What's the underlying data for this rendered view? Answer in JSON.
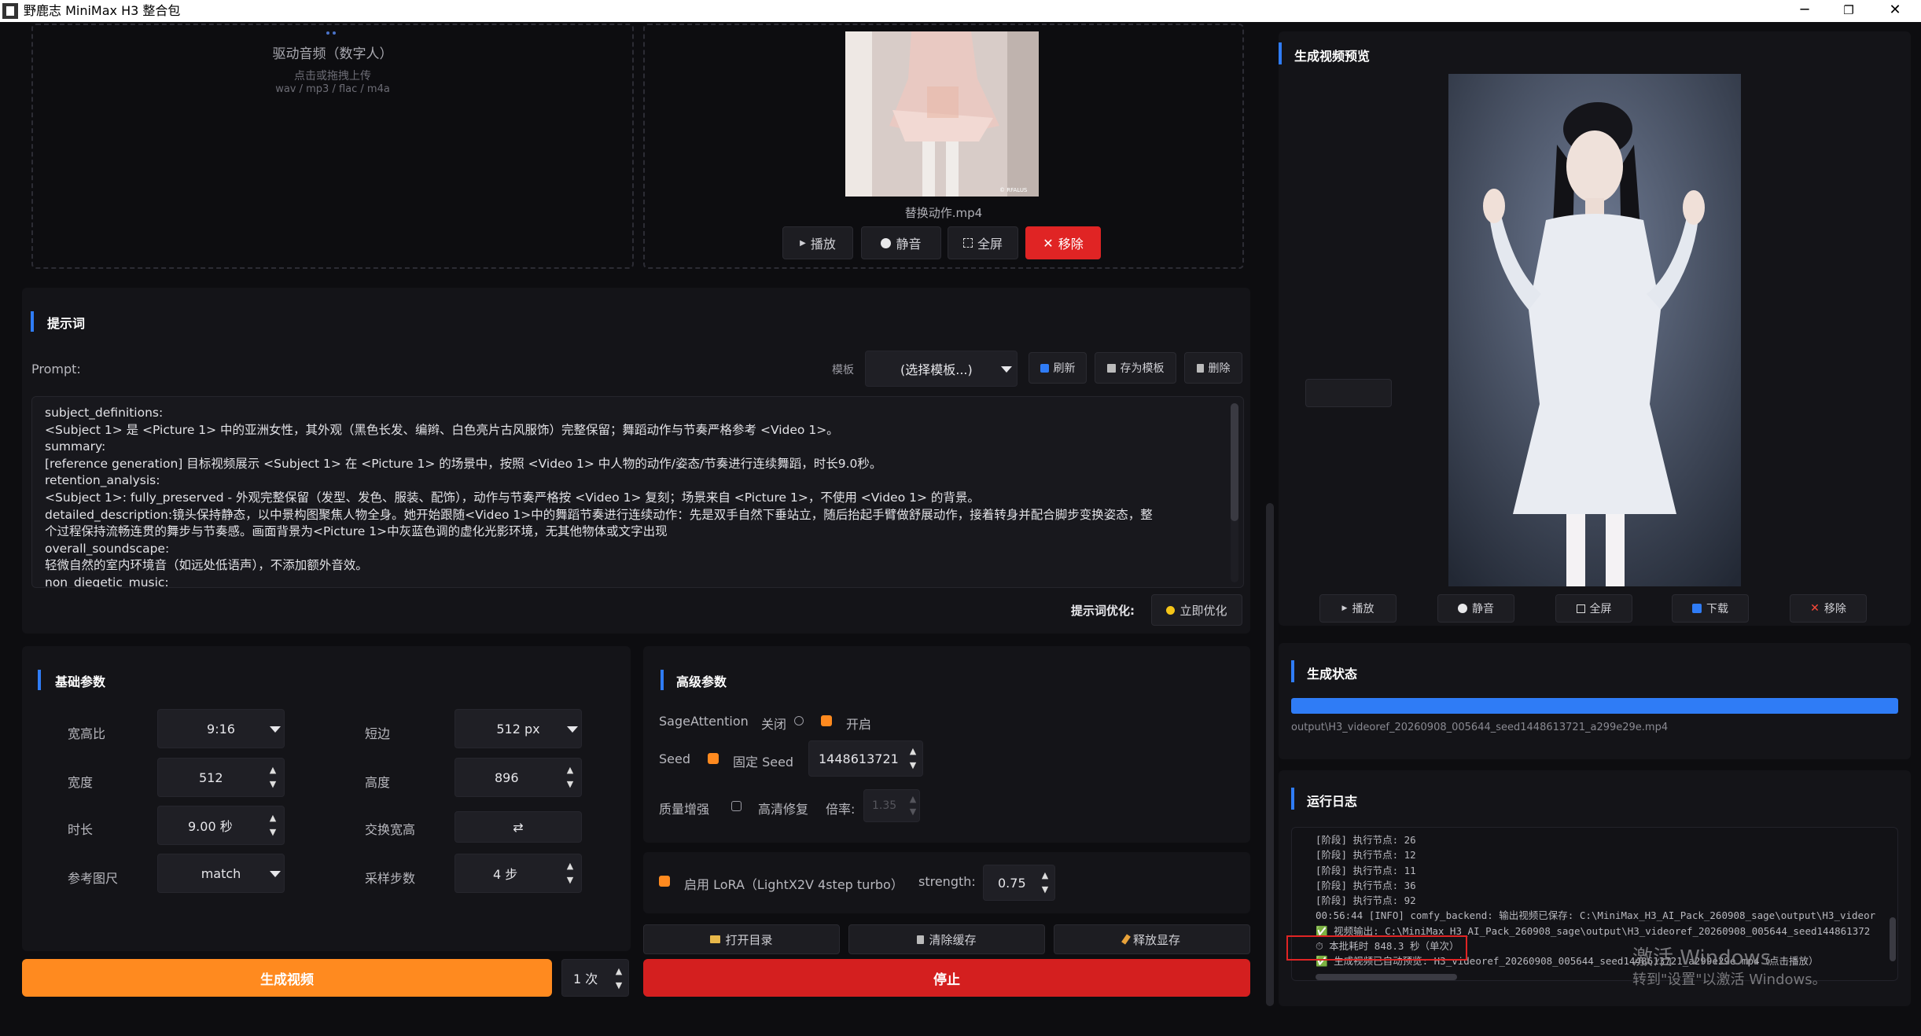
{
  "window": {
    "title": "野鹿志 MiniMax H3 整合包",
    "minimize": "─",
    "restore": "❐",
    "close": "✕"
  },
  "upload_audio": {
    "title": "驱动音频（数字人）",
    "hint": "点击或拖拽上传",
    "formats": "wav / mp3 / flac / m4a"
  },
  "video_ref": {
    "filename": "替换动作.mp4",
    "watermark": "© RFALUS",
    "buttons": {
      "play": "播放",
      "mute": "静音",
      "fullscreen": "全屏",
      "remove": "移除"
    }
  },
  "prompt_section": {
    "title": "提示词",
    "prompt_label": "Prompt:",
    "template_label": "模板",
    "template_select": "(选择模板...)",
    "refresh": "刷新",
    "save_template": "存为模板",
    "delete": "删除",
    "lines": [
      "subject_definitions:",
      "<Subject 1> 是 <Picture 1> 中的亚洲女性，其外观（黑色长发、编辫、白色亮片古风服饰）完整保留；舞蹈动作与节奏严格参考 <Video 1>。",
      "summary:",
      "[reference generation] 目标视频展示 <Subject 1> 在 <Picture 1> 的场景中，按照 <Video 1> 中人物的动作/姿态/节奏进行连续舞蹈，时长9.0秒。",
      "retention_analysis:",
      "<Subject 1>: fully_preserved - 外观完整保留（发型、发色、服装、配饰），动作与节奏严格按 <Video 1> 复刻；场景来自 <Picture 1>，不使用 <Video 1> 的背景。",
      "detailed_description:镜头保持静态，以中景构图聚焦人物全身。她开始跟随<Video 1>中的舞蹈节奏进行连续动作：先是双手自然下垂站立，随后抬起手臂做舒展动作，接着转身并配合脚步变换姿态，整",
      "个过程保持流畅连贯的舞步与节奏感。画面背景为<Picture 1>中灰蓝色调的虚化光影环境，无其他物体或文字出现",
      "overall_soundscape:",
      "轻微自然的室内环境音（如远处低语声），不添加额外音效。",
      "non_diegetic_music:"
    ],
    "optimize_label": "提示词优化:",
    "optimize_button": "立即优化"
  },
  "basic_params": {
    "title": "基础参数",
    "aspect_label": "宽高比",
    "aspect_value": "9:16",
    "short_edge_label": "短边",
    "short_edge_value": "512 px",
    "width_label": "宽度",
    "width_value": "512",
    "height_label": "高度",
    "height_value": "896",
    "duration_label": "时长",
    "duration_value": "9.00 秒",
    "swap_label": "交换宽高",
    "swap_icon": "⇄",
    "ref_size_label": "参考图尺",
    "ref_size_value": "match",
    "steps_label": "采样步数",
    "steps_value": "4 步"
  },
  "advanced_params": {
    "title": "高级参数",
    "sage_label": "SageAttention",
    "sage_off": "关闭",
    "sage_on": "开启",
    "seed_label": "Seed",
    "seed_fixed_label": "固定 Seed",
    "seed_value": "1448613721",
    "quality_label": "质量增强",
    "hires_label": "高清修复",
    "scale_label": "倍率:",
    "scale_value": "1.35",
    "lora_label": "启用 LoRA（LightX2V 4step turbo）",
    "strength_label": "strength:",
    "strength_value": "0.75"
  },
  "utility_buttons": {
    "open_dir": "打开目录",
    "clear_cache": "清除缓存",
    "free_vram": "释放显存"
  },
  "actions": {
    "generate": "生成视频",
    "count": "1 次",
    "stop": "停止"
  },
  "preview": {
    "title": "生成视频预览",
    "buttons": {
      "play": "播放",
      "mute": "静音",
      "fullscreen": "全屏",
      "download": "下载",
      "remove": "移除"
    }
  },
  "status": {
    "title": "生成状态",
    "progress": 1.0,
    "output_path": "output\\H3_videoref_20260908_005644_seed1448613721_a299e29e.mp4"
  },
  "log": {
    "title": "运行日志",
    "lines": [
      "[阶段] 执行节点: 26",
      "[阶段] 执行节点: 12",
      "[阶段] 执行节点: 11",
      "[阶段] 执行节点: 36",
      "[阶段] 执行节点: 92",
      "00:56:44 [INFO] comfy_backend: 输出视频已保存: C:\\MiniMax_H3_AI_Pack_260908_sage\\output\\H3_videor",
      "✅ 视频输出: C:\\MiniMax_H3_AI_Pack_260908_sage\\output\\H3_videoref_20260908_005644_seed144861372",
      "⏱ 本批耗时 848.3 秒（单次）",
      "✅ 生成视频已自动预览: H3_videoref_20260908_005644_seed1448613721_a299e29e.mp4（点击播放）"
    ]
  },
  "watermark": {
    "line1": "激活 Windows",
    "line2": "转到\"设置\"以激活 Windows。"
  },
  "colors": {
    "accent": "#2f7cf6",
    "orange": "#ff8a1f",
    "red": "#e02424"
  }
}
